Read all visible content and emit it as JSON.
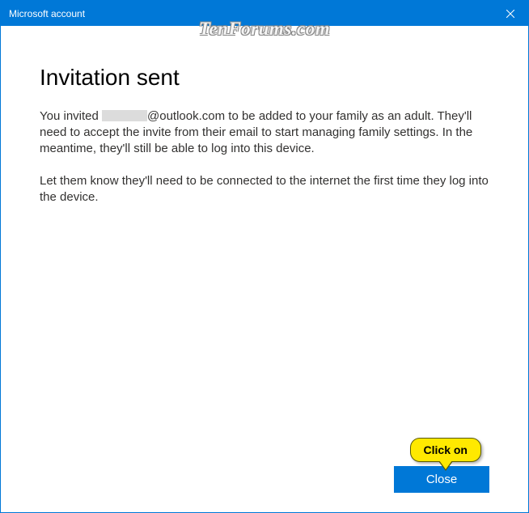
{
  "titlebar": {
    "title": "Microsoft account"
  },
  "content": {
    "heading": "Invitation sent",
    "paragraph1_prefix": "You invited ",
    "paragraph1_email_suffix": "@outlook.com",
    "paragraph1_rest": " to be added to your family as an adult. They'll need to accept the invite from their email to start managing family settings. In the meantime, they'll still be able to log into this device.",
    "paragraph2": "Let them know they'll need to be connected to the internet the first time they log into the device."
  },
  "footer": {
    "close_label": "Close"
  },
  "watermark": {
    "text": "TenForums.com"
  },
  "callout": {
    "text": "Click on"
  }
}
